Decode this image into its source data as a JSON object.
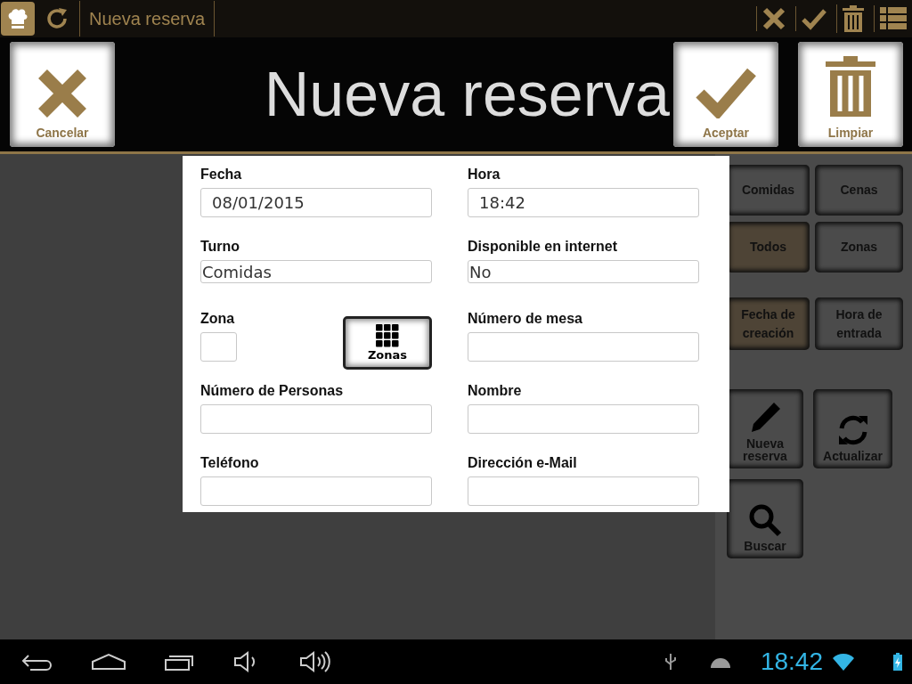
{
  "action_bar": {
    "title": "Nueva reserva"
  },
  "header": {
    "title": "Nueva reserva",
    "buttons": [
      {
        "label": "Cancelar",
        "kind": "cancel"
      },
      {
        "label": "Aceptar",
        "kind": "accept"
      },
      {
        "label": "Limpiar",
        "kind": "clear"
      }
    ]
  },
  "form": {
    "fields": [
      {
        "label": "Fecha",
        "value": "08/01/2015",
        "kind": "text"
      },
      {
        "label": "Hora",
        "value": "18:42",
        "kind": "text"
      },
      {
        "label": "Turno",
        "value": "Comidas",
        "kind": "select"
      },
      {
        "label": "Disponible en internet",
        "value": "No",
        "kind": "select"
      },
      {
        "label": "Zona",
        "kind": "zone",
        "button": "Zonas"
      },
      {
        "label": "Número de mesa",
        "kind": "text"
      },
      {
        "label": "Número de Personas",
        "kind": "text"
      },
      {
        "label": "Nombre",
        "kind": "text"
      },
      {
        "label": "Teléfono",
        "kind": "text"
      },
      {
        "label": "Dirección e-Mail",
        "kind": "text"
      }
    ]
  },
  "side_panel": {
    "filters": [
      {
        "label": "Comidas",
        "selected": false
      },
      {
        "label": "Cenas",
        "selected": false
      },
      {
        "label": "Todos",
        "selected": true
      },
      {
        "label": "Zonas",
        "selected": false
      }
    ],
    "sort": [
      {
        "label": "Fecha de creación",
        "selected": true
      },
      {
        "label": "Hora de entrada",
        "selected": false
      }
    ],
    "actions": [
      {
        "label": "Nueva reserva",
        "kind": "new"
      },
      {
        "label": "Actualizar",
        "kind": "refresh"
      },
      {
        "label": "Buscar",
        "kind": "search"
      }
    ]
  },
  "status_bar": {
    "time": "18:42"
  }
}
